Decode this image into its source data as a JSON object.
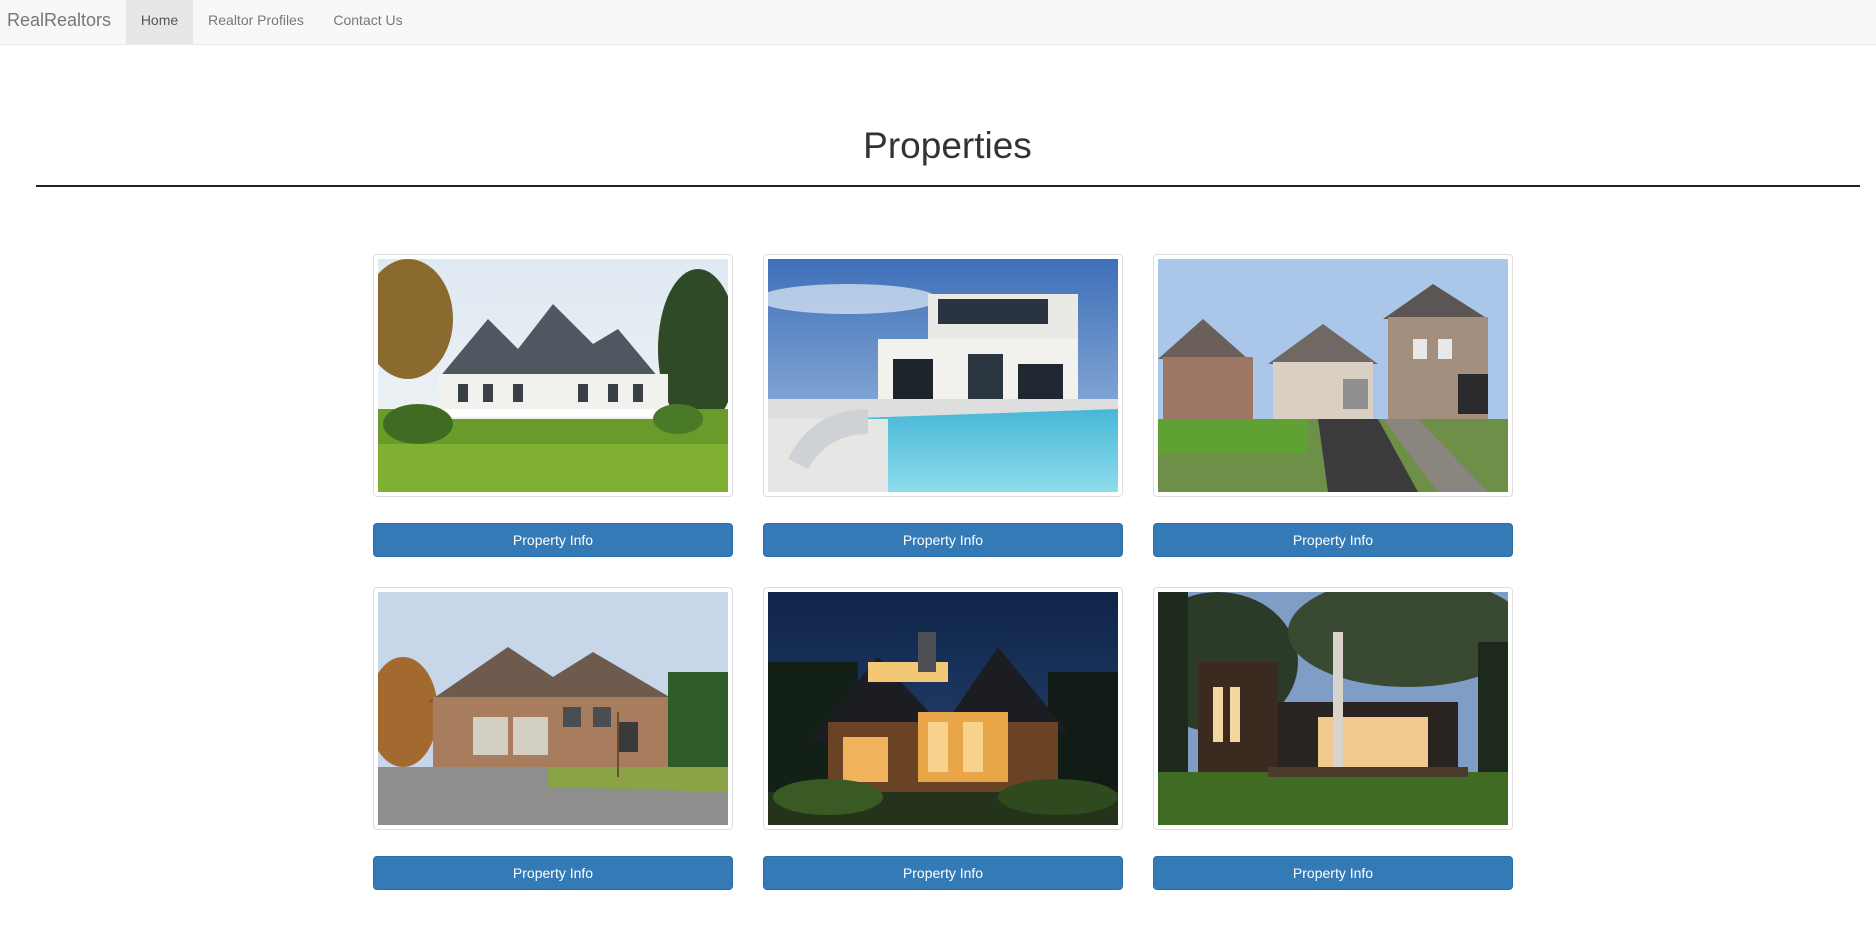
{
  "navbar": {
    "brand": "RealRealtors",
    "items": [
      {
        "label": "Home",
        "active": true
      },
      {
        "label": "Realtor Profiles",
        "active": false
      },
      {
        "label": "Contact Us",
        "active": false
      }
    ]
  },
  "main": {
    "title": "Properties",
    "properties": [
      {
        "button_label": "Property Info"
      },
      {
        "button_label": "Property Info"
      },
      {
        "button_label": "Property Info"
      },
      {
        "button_label": "Property Info"
      },
      {
        "button_label": "Property Info"
      },
      {
        "button_label": "Property Info"
      }
    ]
  },
  "colors": {
    "navbar_bg": "#f8f8f8",
    "active_nav_bg": "#e7e7e7",
    "button_primary": "#337ab7",
    "button_border": "#2e6da4"
  }
}
